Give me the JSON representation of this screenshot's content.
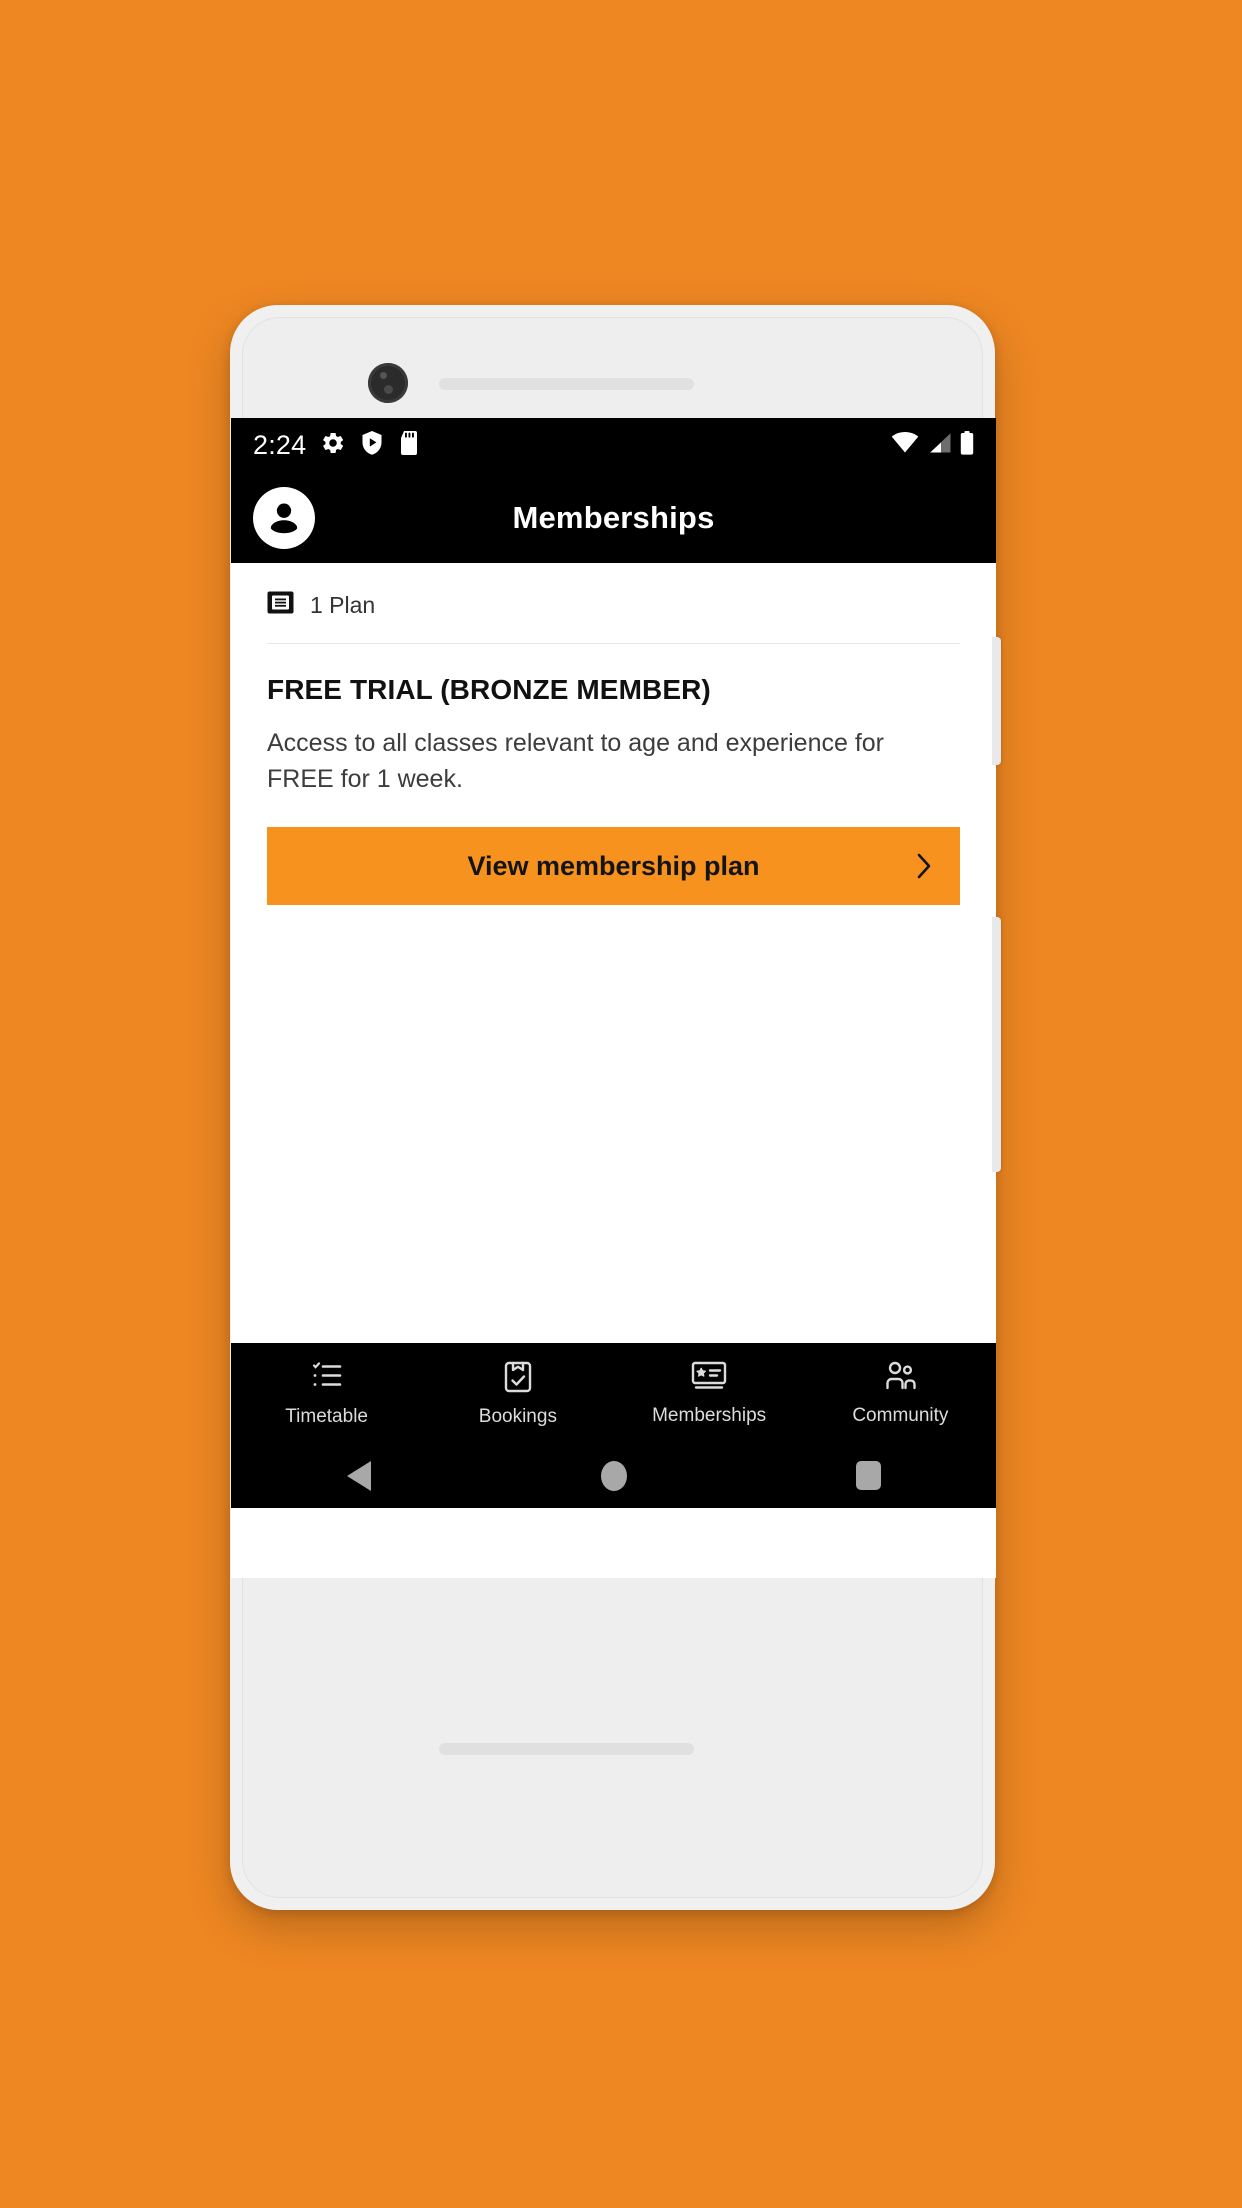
{
  "theme": {
    "page_background": "#EE8722",
    "accent_orange": "#F7921E",
    "bar_black": "#000000",
    "screen_white": "#FFFFFF",
    "divider": "#E6E6E6",
    "nav_key_gray": "#A8A8A8"
  },
  "device": {
    "front_camera": "front-camera",
    "earpiece": "earpiece-speaker",
    "bottom_speaker": "bottom-speaker",
    "power_button": "power-button",
    "volume_button": "volume-rocker"
  },
  "status_bar": {
    "time": "2:24",
    "left_icons": [
      "gear-icon",
      "shield-play-icon",
      "sd-card-icon"
    ],
    "right_icons": [
      "wifi-icon",
      "cellular-signal-icon",
      "battery-icon"
    ]
  },
  "app_bar": {
    "title": "Memberships",
    "avatar": "account-avatar"
  },
  "content": {
    "plan_count": "1 Plan",
    "plan_count_icon": "plan-card-icon",
    "plan": {
      "title": "FREE TRIAL (BRONZE MEMBER)",
      "description": "Access to all classes relevant to age and experience for FREE for 1 week.",
      "cta_label": "View membership plan",
      "cta_icon": "chevron-right-icon"
    }
  },
  "tab_bar": {
    "active": "Memberships",
    "items": [
      {
        "label": "Timetable",
        "icon": "timetable-list-icon"
      },
      {
        "label": "Bookings",
        "icon": "clipboard-check-icon"
      },
      {
        "label": "Memberships",
        "icon": "membership-card-icon"
      },
      {
        "label": "Community",
        "icon": "people-group-icon"
      }
    ]
  },
  "nav_bar": {
    "back": "back-triangle",
    "home": "home-circle",
    "recents": "recents-square"
  }
}
